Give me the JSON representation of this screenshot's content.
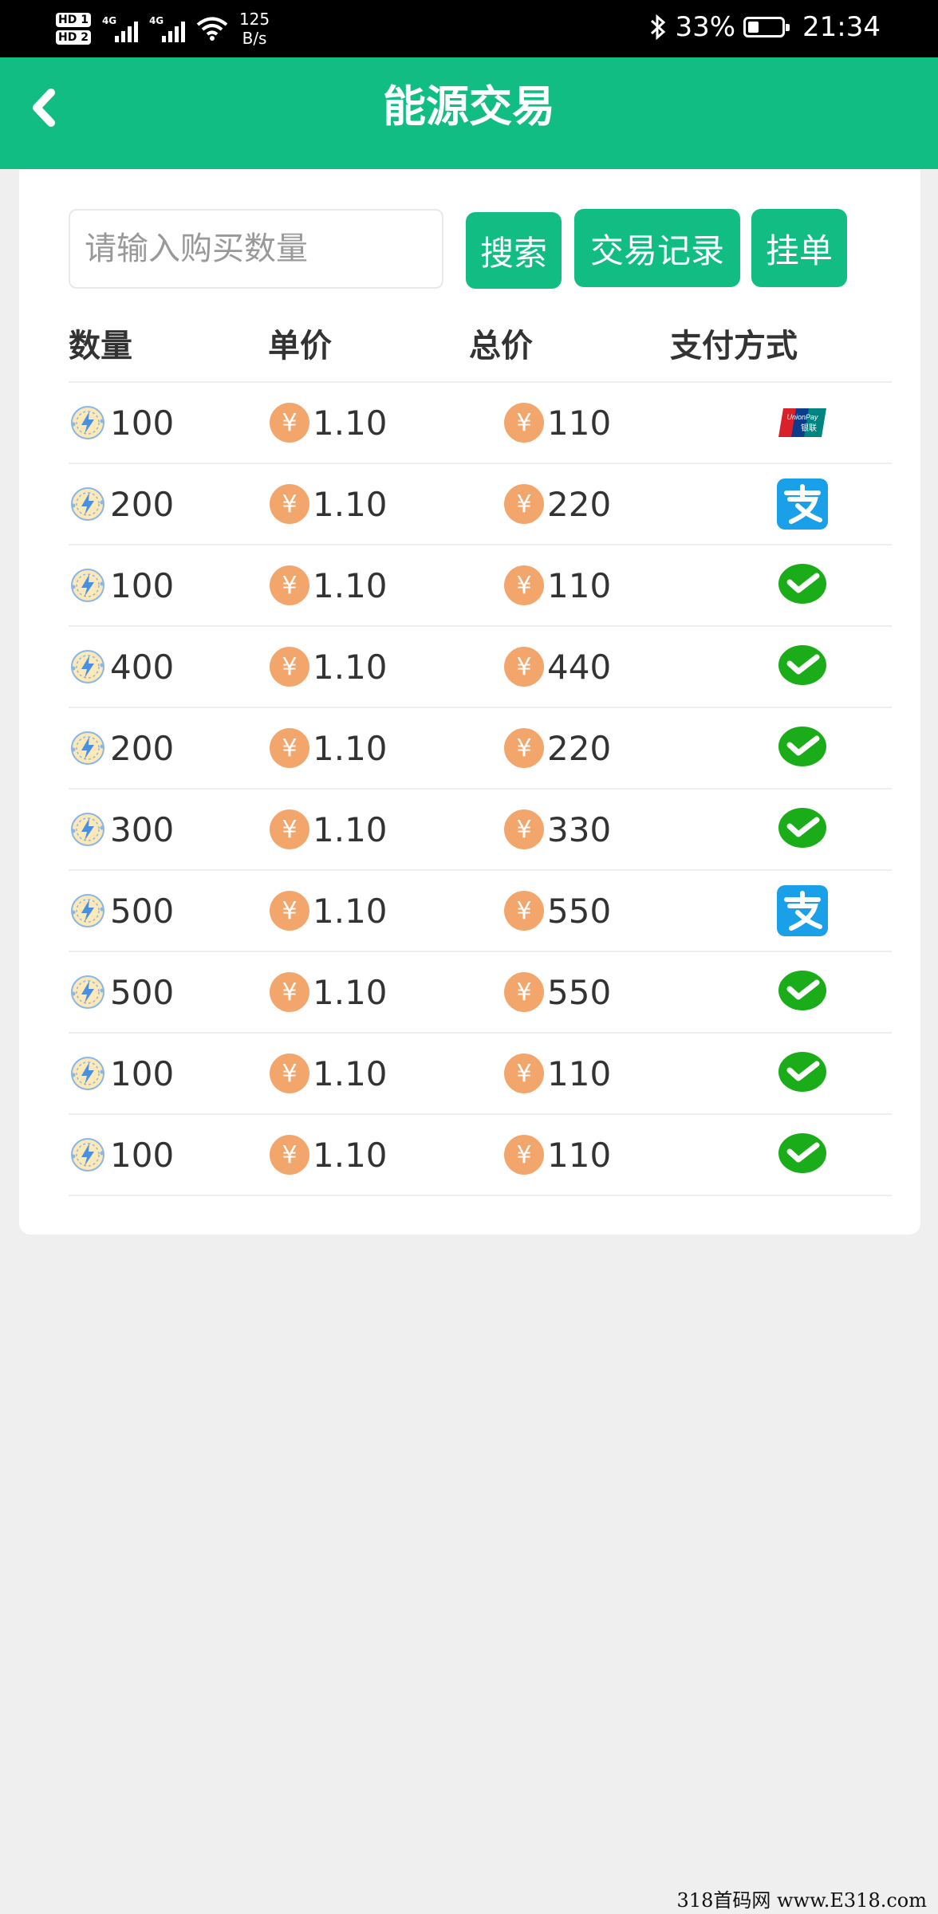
{
  "status_bar": {
    "sim1": "HD 1",
    "sim2": "HD 2",
    "net1": "4G",
    "net2": "4G",
    "speed_value": "125",
    "speed_unit": "B/s",
    "battery": "33%",
    "time": "21:34"
  },
  "header": {
    "title": "能源交易"
  },
  "search": {
    "placeholder": "请输入购买数量",
    "value": ""
  },
  "buttons": {
    "search": "搜索",
    "records": "交易记录",
    "list_order": "挂单"
  },
  "table": {
    "headers": [
      "数量",
      "单价",
      "总价",
      "支付方式"
    ],
    "currency_symbol": "¥",
    "rows": [
      {
        "qty": "100",
        "price": "1.10",
        "total": "110",
        "pay": "unionpay-icon"
      },
      {
        "qty": "200",
        "price": "1.10",
        "total": "220",
        "pay": "alipay-icon"
      },
      {
        "qty": "100",
        "price": "1.10",
        "total": "110",
        "pay": "wechat-pay-icon"
      },
      {
        "qty": "400",
        "price": "1.10",
        "total": "440",
        "pay": "wechat-pay-icon"
      },
      {
        "qty": "200",
        "price": "1.10",
        "total": "220",
        "pay": "wechat-pay-icon"
      },
      {
        "qty": "300",
        "price": "1.10",
        "total": "330",
        "pay": "wechat-pay-icon"
      },
      {
        "qty": "500",
        "price": "1.10",
        "total": "550",
        "pay": "alipay-icon"
      },
      {
        "qty": "500",
        "price": "1.10",
        "total": "550",
        "pay": "wechat-pay-icon"
      },
      {
        "qty": "100",
        "price": "1.10",
        "total": "110",
        "pay": "wechat-pay-icon"
      },
      {
        "qty": "100",
        "price": "1.10",
        "total": "110",
        "pay": "wechat-pay-icon"
      }
    ]
  },
  "colors": {
    "brand_green": "#12bd84",
    "coin_orange": "#f2a66c",
    "alipay_blue": "#1aa0e8",
    "wechat_green": "#1aad19"
  },
  "unionpay": {
    "line1": "UnionPay",
    "line2": "银联"
  },
  "watermark": "318首码网 www.E318.com"
}
